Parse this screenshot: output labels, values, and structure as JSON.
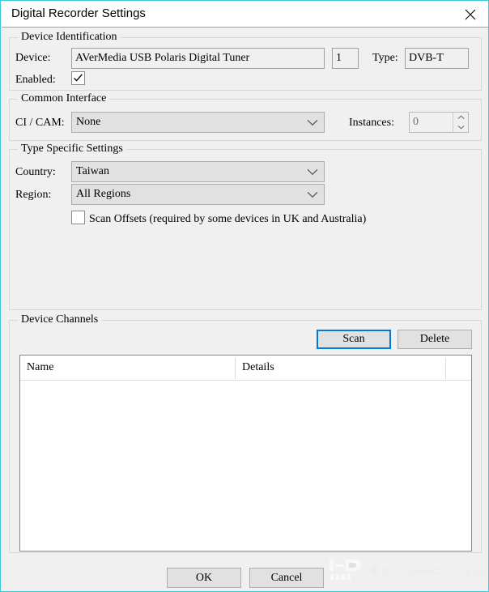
{
  "window": {
    "title": "Digital Recorder Settings",
    "close_icon": "close-icon",
    "accent_border": "#3ec8d8",
    "face_color": "#f0f0f0"
  },
  "device_identification": {
    "legend": "Device Identification",
    "device_label": "Device:",
    "device_value": "AVerMedia USB Polaris Digital Tuner",
    "device_index_value": "1",
    "type_label": "Type:",
    "type_value": "DVB-T",
    "enabled_label": "Enabled:",
    "enabled_checked": true
  },
  "common_interface": {
    "legend": "Common Interface",
    "cicam_label": "CI / CAM:",
    "cicam_value": "None",
    "instances_label": "Instances:",
    "instances_value": "0",
    "instances_disabled": true
  },
  "type_specific_settings": {
    "legend": "Type Specific Settings",
    "country_label": "Country:",
    "country_value": "Taiwan",
    "region_label": "Region:",
    "region_value": "All Regions",
    "scan_offsets_label": "Scan Offsets (required by some devices in UK and Australia)",
    "scan_offsets_checked": false
  },
  "device_channels": {
    "legend": "Device Channels",
    "scan_button": "Scan",
    "scan_focused": true,
    "delete_button": "Delete",
    "columns": [
      {
        "label": "Name"
      },
      {
        "label": "Details"
      }
    ],
    "rows": []
  },
  "footer": {
    "ok_button": "OK",
    "cancel_button": "Cancel"
  },
  "watermark": {
    "text": "© 2017 www.HD.Club.tw",
    "logo_top": "HD",
    "logo_bottom": "CLUB"
  }
}
